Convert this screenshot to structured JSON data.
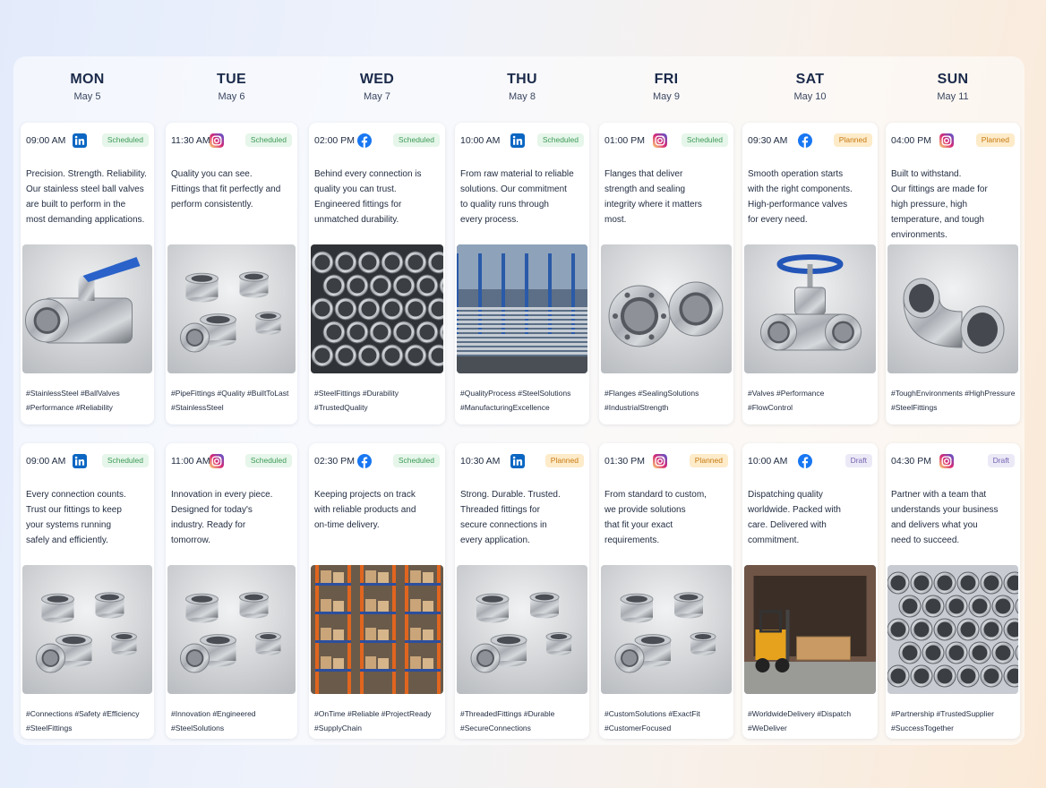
{
  "days": [
    {
      "name": "MON",
      "date": "May 5"
    },
    {
      "name": "TUE",
      "date": "May 6"
    },
    {
      "name": "WED",
      "date": "May 7"
    },
    {
      "name": "THU",
      "date": "May 8"
    },
    {
      "name": "FRI",
      "date": "May 9"
    },
    {
      "name": "SAT",
      "date": "May 10"
    },
    {
      "name": "SUN",
      "date": "May 11"
    }
  ],
  "colors": {
    "linkedin": "#0a66c2",
    "facebook": "#1877f2",
    "instagram_start": "#feda75",
    "instagram_mid": "#d62976",
    "instagram_end": "#4f5bd5",
    "scheduled": "#3e9a57",
    "planned": "#c77a12",
    "draft": "#7463b0"
  },
  "posts": [
    {
      "time": "09:00 AM",
      "platform": "linkedin-icon",
      "status": "Scheduled",
      "caption": [
        "Precision. Strength. Reliability.",
        "Our stainless steel ball valves",
        "are built to perform in the",
        "most demanding applications."
      ],
      "image": "ball-valve-image",
      "hashtags": [
        "#StainlessSteel #BallValves",
        "#Performance #Reliability"
      ]
    },
    {
      "time": "11:30 AM",
      "platform": "instagram-icon",
      "status": "Scheduled",
      "caption": [
        "Quality you can see.",
        "Fittings that fit perfectly and",
        "perform consistently."
      ],
      "image": "pipe-fittings-image",
      "hashtags": [
        "#PipeFittings #Quality #BuiltToLast",
        "#StainlessSteel"
      ]
    },
    {
      "time": "02:00 PM",
      "platform": "facebook-icon",
      "status": "Scheduled",
      "caption": [
        "Behind every connection is",
        "quality you can trust.",
        "Engineered fittings for",
        "unmatched durability."
      ],
      "image": "steel-pipes-image",
      "hashtags": [
        "#SteelFittings #Durability",
        "#TrustedQuality"
      ]
    },
    {
      "time": "10:00 AM",
      "platform": "linkedin-icon",
      "status": "Scheduled",
      "caption": [
        "From raw material to reliable",
        "solutions. Our commitment",
        "to quality runs through",
        "every process."
      ],
      "image": "factory-image",
      "hashtags": [
        "#QualityProcess #SteelSolutions",
        "#ManufacturingExcellence"
      ]
    },
    {
      "time": "01:00 PM",
      "platform": "instagram-icon",
      "status": "Scheduled",
      "caption": [
        "Flanges that deliver",
        "strength and sealing",
        "integrity where it matters",
        "most."
      ],
      "image": "flanges-image",
      "hashtags": [
        "#Flanges #SealingSolutions",
        "#IndustrialStrength"
      ]
    },
    {
      "time": "09:30 AM",
      "platform": "facebook-icon",
      "status": "Planned",
      "caption": [
        "Smooth operation starts",
        "with the right components.",
        "High-performance valves",
        "for every need."
      ],
      "image": "gate-valve-image",
      "hashtags": [
        "#Valves #Performance",
        "#FlowControl"
      ]
    },
    {
      "time": "04:00 PM",
      "platform": "instagram-icon",
      "status": "Planned",
      "caption": [
        "Built to withstand.",
        "Our fittings are made for",
        "high pressure, high",
        "temperature, and tough",
        "environments."
      ],
      "image": "elbow-fitting-image",
      "hashtags": [
        "#ToughEnvironments #HighPressure",
        "#SteelFittings"
      ]
    },
    {
      "time": "09:00 AM",
      "platform": "linkedin-icon",
      "status": "Scheduled",
      "caption": [
        "Every connection counts.",
        "Trust our fittings to keep",
        "your systems running",
        "safely and efficiently."
      ],
      "image": "threaded-fittings-image",
      "hashtags": [
        "#Connections #Safety #Efficiency",
        "#SteelFittings"
      ]
    },
    {
      "time": "11:00 AM",
      "platform": "instagram-icon",
      "status": "Scheduled",
      "caption": [
        "Innovation in every piece.",
        "Designed for today's",
        "industry. Ready for",
        "tomorrow."
      ],
      "image": "couplings-image",
      "hashtags": [
        "#Innovation #Engineered",
        "#SteelSolutions"
      ]
    },
    {
      "time": "02:30 PM",
      "platform": "facebook-icon",
      "status": "Scheduled",
      "caption": [
        "Keeping projects on track",
        "with reliable products and",
        "on-time delivery."
      ],
      "image": "warehouse-image",
      "hashtags": [
        "#OnTime #Reliable #ProjectReady",
        "#SupplyChain"
      ]
    },
    {
      "time": "10:30 AM",
      "platform": "linkedin-icon",
      "status": "Planned",
      "caption": [
        "Strong. Durable. Trusted.",
        "Threaded fittings for",
        "secure connections in",
        "every application."
      ],
      "image": "threaded-set-image",
      "hashtags": [
        "#ThreadedFittings #Durable",
        "#SecureConnections"
      ]
    },
    {
      "time": "01:30 PM",
      "platform": "instagram-icon",
      "status": "Planned",
      "caption": [
        "From standard to custom,",
        "we provide solutions",
        "that fit your exact",
        "requirements."
      ],
      "image": "custom-fittings-image",
      "hashtags": [
        "#CustomSolutions #ExactFit",
        "#CustomerFocused"
      ]
    },
    {
      "time": "10:00 AM",
      "platform": "facebook-icon",
      "status": "Draft",
      "caption": [
        "Dispatching quality",
        "worldwide. Packed with",
        "care. Delivered with",
        "commitment."
      ],
      "image": "forklift-container-image",
      "hashtags": [
        "#WorldwideDelivery #Dispatch",
        "#WeDeliver"
      ]
    },
    {
      "time": "04:30 PM",
      "platform": "instagram-icon",
      "status": "Draft",
      "caption": [
        "Partner with a team that",
        "understands your business",
        "and delivers what you",
        "need to succeed."
      ],
      "image": "pipe-stacks-image",
      "hashtags": [
        "#Partnership #TrustedSupplier",
        "#SuccessTogether"
      ]
    }
  ]
}
